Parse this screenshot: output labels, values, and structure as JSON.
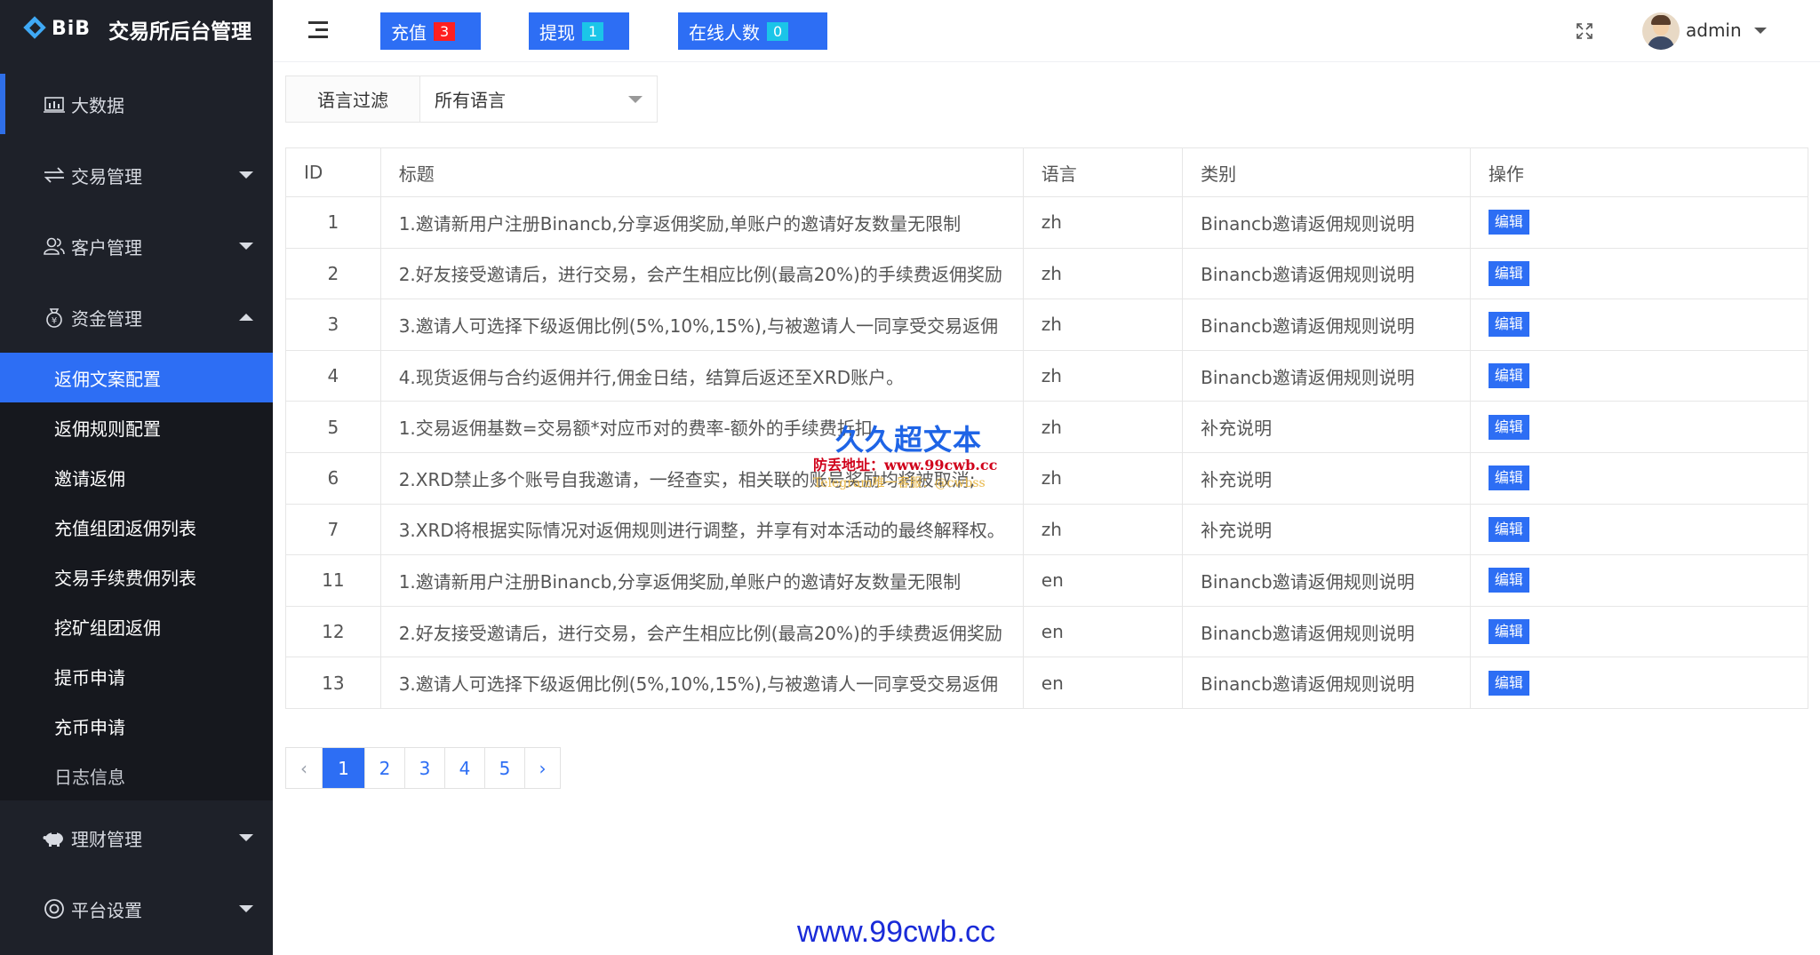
{
  "app": {
    "brand": "BiB",
    "title": "交易所后台管理"
  },
  "sidebar": {
    "top_items": [
      {
        "label": "大数据",
        "icon": "chart-icon"
      },
      {
        "label": "交易管理",
        "icon": "transfer-icon"
      },
      {
        "label": "客户管理",
        "icon": "users-icon"
      },
      {
        "label": "资金管理",
        "icon": "money-bag-icon"
      }
    ],
    "sub_items": [
      {
        "label": "返佣文案配置"
      },
      {
        "label": "返佣规则配置"
      },
      {
        "label": "邀请返佣"
      },
      {
        "label": "充值组团返佣列表"
      },
      {
        "label": "交易手续费佣列表"
      },
      {
        "label": "挖矿组团返佣"
      },
      {
        "label": "提币申请"
      },
      {
        "label": "充币申请"
      },
      {
        "label": "日志信息"
      }
    ],
    "bottom_items": [
      {
        "label": "理财管理",
        "icon": "piggy-bank-icon"
      },
      {
        "label": "平台设置",
        "icon": "settings-icon"
      }
    ]
  },
  "topbar": {
    "recharge": {
      "label": "充值",
      "count": "3",
      "badge_color": "#ff1f1f"
    },
    "withdraw": {
      "label": "提现",
      "count": "1",
      "badge_color": "#1bc5e8"
    },
    "online": {
      "label": "在线人数",
      "count": "0",
      "badge_color": "#1bc5e8"
    },
    "user": "admin"
  },
  "filter": {
    "label": "语言过滤",
    "selected": "所有语言"
  },
  "table": {
    "headers": [
      "ID",
      "标题",
      "语言",
      "类别",
      "操作"
    ],
    "rows": [
      {
        "id": "1",
        "title": "1.邀请新用户注册Binancb,分享返佣奖励,单账户的邀请好友数量无限制",
        "lang": "zh",
        "category": "Binancb邀请返佣规则说明",
        "action": "编辑"
      },
      {
        "id": "2",
        "title": "2.好友接受邀请后，进行交易，会产生相应比例(最高20%)的手续费返佣奖励",
        "lang": "zh",
        "category": "Binancb邀请返佣规则说明",
        "action": "编辑"
      },
      {
        "id": "3",
        "title": "3.邀请人可选择下级返佣比例(5%,10%,15%),与被邀请人一同享受交易返佣",
        "lang": "zh",
        "category": "Binancb邀请返佣规则说明",
        "action": "编辑"
      },
      {
        "id": "4",
        "title": "4.现货返佣与合约返佣并行,佣金日结，结算后返还至XRD账户。",
        "lang": "zh",
        "category": "Binancb邀请返佣规则说明",
        "action": "编辑"
      },
      {
        "id": "5",
        "title": "1.交易返佣基数=交易额*对应币对的费率-额外的手续费折扣",
        "lang": "zh",
        "category": "补充说明",
        "action": "编辑"
      },
      {
        "id": "6",
        "title": "2.XRD禁止多个账号自我邀请，一经查实，相关联的账号奖励均将被取消;",
        "lang": "zh",
        "category": "补充说明",
        "action": "编辑"
      },
      {
        "id": "7",
        "title": "3.XRD将根据实际情况对返佣规则进行调整，并享有对本活动的最终解释权。",
        "lang": "zh",
        "category": "补充说明",
        "action": "编辑"
      },
      {
        "id": "11",
        "title": "1.邀请新用户注册Binancb,分享返佣奖励,单账户的邀请好友数量无限制",
        "lang": "en",
        "category": "Binancb邀请返佣规则说明",
        "action": "编辑"
      },
      {
        "id": "12",
        "title": "2.好友接受邀请后，进行交易，会产生相应比例(最高20%)的手续费返佣奖励",
        "lang": "en",
        "category": "Binancb邀请返佣规则说明",
        "action": "编辑"
      },
      {
        "id": "13",
        "title": "3.邀请人可选择下级返佣比例(5%,10%,15%),与被邀请人一同享受交易返佣",
        "lang": "en",
        "category": "Binancb邀请返佣规则说明",
        "action": "编辑"
      }
    ]
  },
  "pagination": {
    "prev": "‹",
    "pages": [
      "1",
      "2",
      "3",
      "4",
      "5"
    ],
    "next": "›",
    "current": "1"
  },
  "watermark": {
    "line1": "久久超文本",
    "line2": "防丢地址：www.99cwb.cc",
    "line3": "Telegram唯一客服：@cwbss",
    "footer": "www.99cwb.cc"
  },
  "colors": {
    "accent": "#2d6ef4",
    "sidebar_bg": "#1e2129"
  }
}
